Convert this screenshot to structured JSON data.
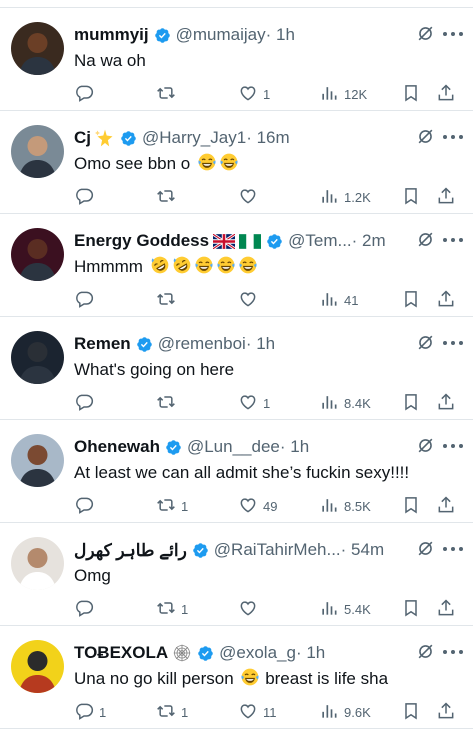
{
  "tweets": [
    {
      "name": "mummyij",
      "handle": "@mumaijay",
      "time": "· 1h",
      "text": "Na wa oh",
      "replies": "",
      "retweets": "",
      "likes": "1",
      "views": "12K",
      "avatar_color": "#3a2a1f",
      "emojis": []
    },
    {
      "name": "Cj",
      "handle": "@Harry_Jay1",
      "time": "· 16m",
      "text": "Omo see bbn o",
      "replies": "",
      "retweets": "",
      "likes": "",
      "views": "1.2K",
      "avatar_color": "#7a8a96",
      "name_emoji": "sparkle-star",
      "emojis": [
        "laughing-tears",
        "laughing-tears"
      ]
    },
    {
      "name": "Energy Goddess",
      "handle": "@Tem...",
      "time": "· 2m",
      "text": "Hmmmm",
      "replies": "",
      "retweets": "",
      "likes": "",
      "views": "41",
      "avatar_color": "#3b1020",
      "name_emoji": "uk-flag nigeria-flag",
      "emojis": [
        "rolling-laughing",
        "rolling-laughing",
        "laughing-tears",
        "laughing-tears",
        "laughing-tears"
      ]
    },
    {
      "name": "Remen",
      "handle": "@remenboi",
      "time": "· 1h",
      "text": "What's going on here",
      "replies": "",
      "retweets": "",
      "likes": "1",
      "views": "8.4K",
      "avatar_color": "#1b2430",
      "emojis": []
    },
    {
      "name": "Ohenewah",
      "handle": "@Lun__dee",
      "time": "· 1h",
      "text": "At least we can all admit she’s fuckin sexy!!!!",
      "replies": "",
      "retweets": "1",
      "likes": "49",
      "views": "8.5K",
      "avatar_color": "#a8b8c8",
      "emojis": []
    },
    {
      "name": "رائے طاہر کھرل",
      "handle": "@RaiTahirMeh...",
      "time": "· 54m",
      "text": "Omg",
      "replies": "",
      "retweets": "1",
      "likes": "",
      "views": "5.4K",
      "avatar_color": "#e6e2dd",
      "emojis": []
    },
    {
      "name": "TOɃEXOLA",
      "handle": "@exola_g",
      "time": "· 1h",
      "text": "Una no go kill person",
      "text2": "breast is life sha",
      "replies": "1",
      "retweets": "1",
      "likes": "11",
      "views": "9.6K",
      "avatar_color": "#f2d21a",
      "name_emoji": "spider-web",
      "emojis": [
        "laughing-tears"
      ]
    }
  ],
  "colors": {
    "accent": "#1d9bf0",
    "muted": "#536471",
    "divider": "#e1e6ea",
    "text": "#0f1419"
  }
}
